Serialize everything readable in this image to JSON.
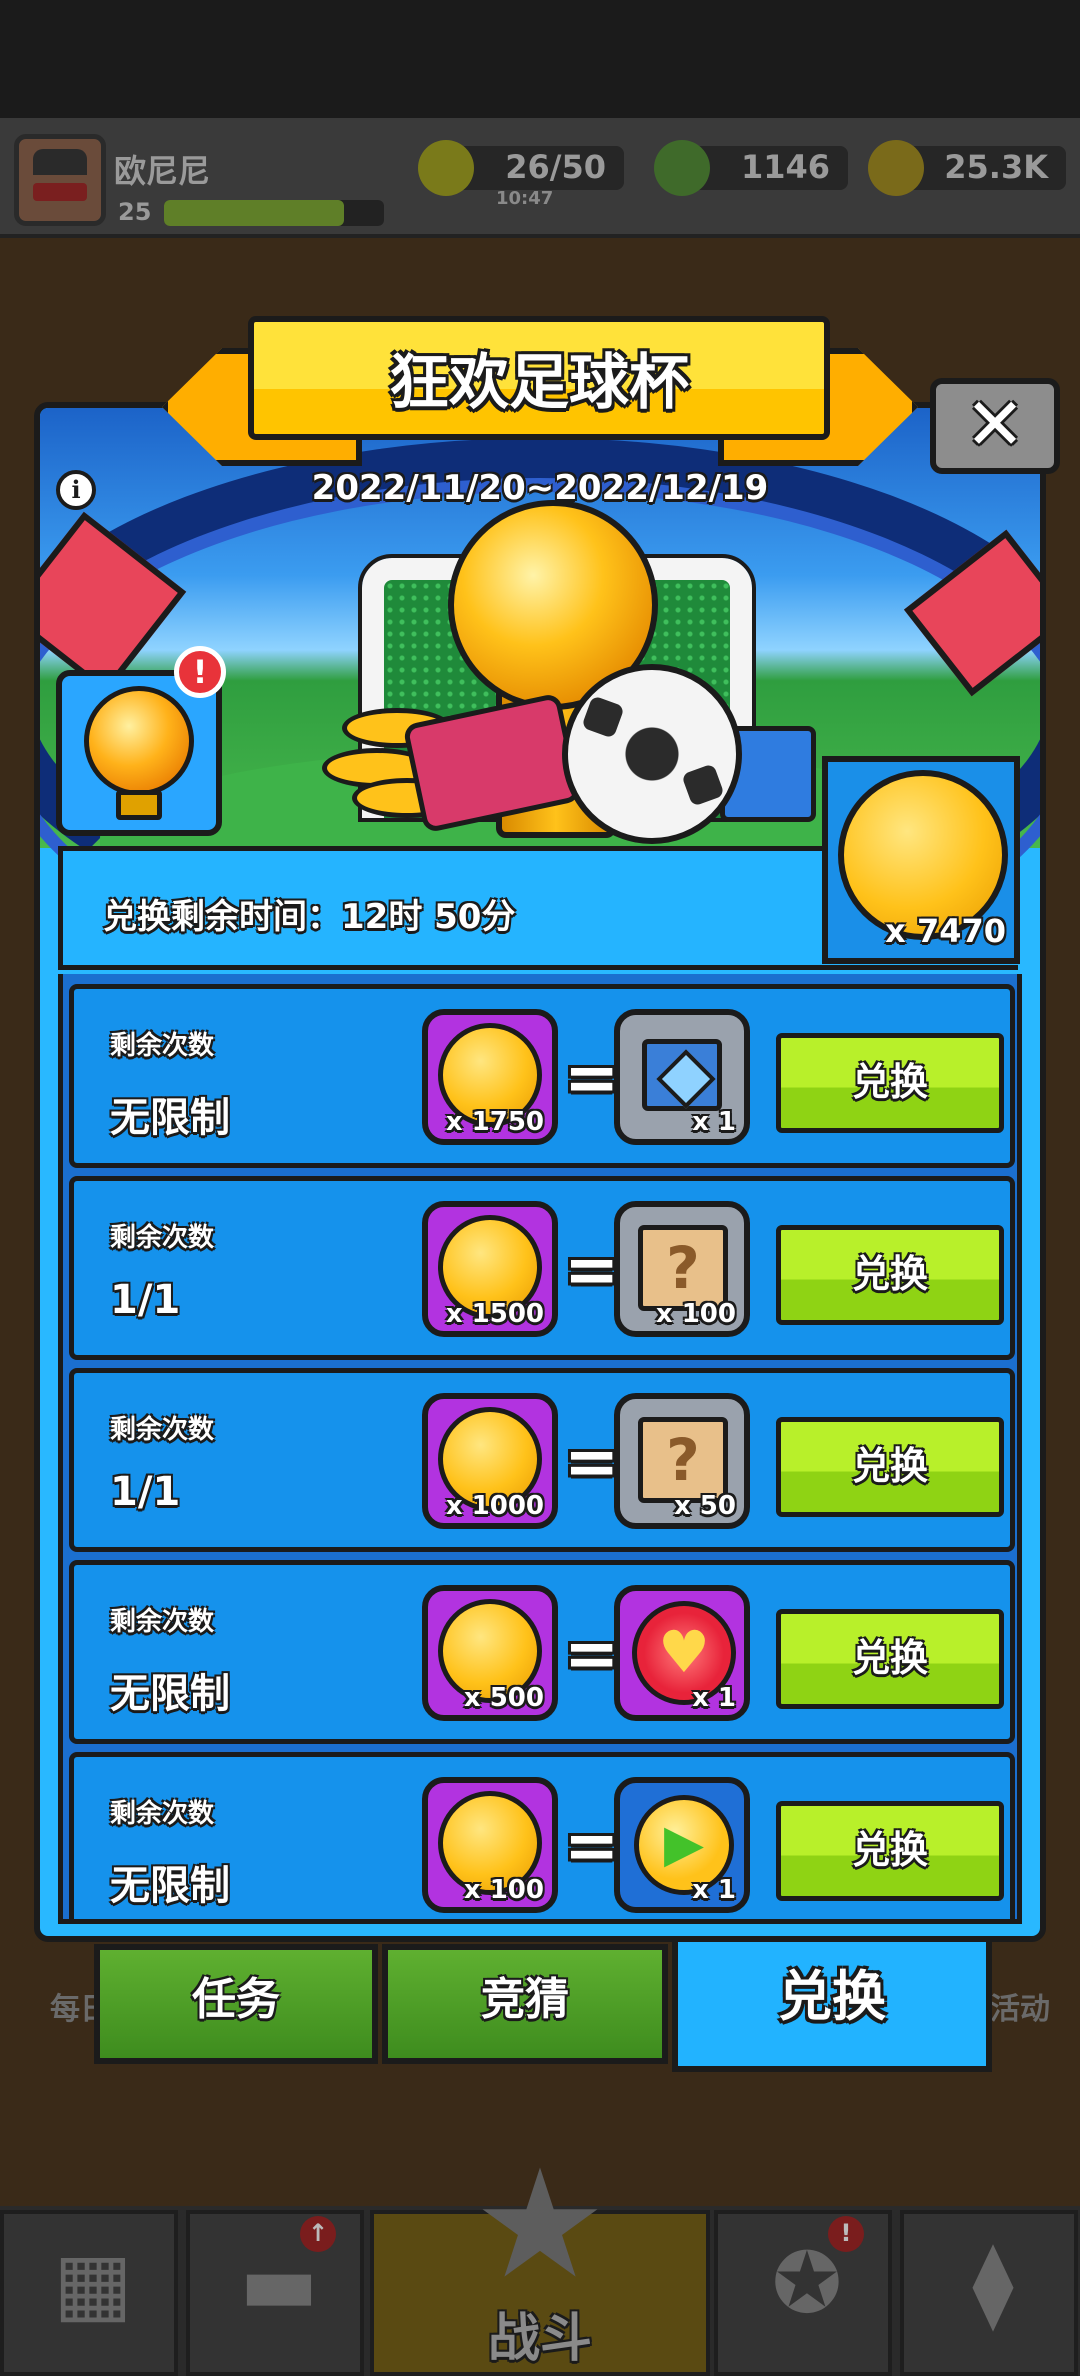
{
  "player": {
    "name": "欧尼尼",
    "level": "25",
    "xp_progress": 0.82
  },
  "resources": {
    "energy": {
      "value": "26/50",
      "timer": "10:47",
      "icon": "lightning-icon"
    },
    "gems": {
      "value": "1146",
      "icon": "gem-icon"
    },
    "coins": {
      "value": "25.3K",
      "icon": "coin-icon"
    }
  },
  "popup": {
    "title": "狂欢足球杯",
    "date_range": "2022/11/20~2022/12/19",
    "close_glyph": "✕",
    "info_glyph": "i",
    "alert_glyph": "!",
    "trophy_currency": "x 7470",
    "remaining_time": "兑换剩余时间：12时 50分"
  },
  "exchange": {
    "items": [
      {
        "label": "剩余次数",
        "limit": "无限制",
        "cost": "x 1750",
        "reward_icon": "chest-icon",
        "reward_qty": "x 1",
        "button": "兑换"
      },
      {
        "label": "剩余次数",
        "limit": "1/1",
        "cost": "x 1500",
        "reward_icon": "scroll-icon",
        "reward_qty": "x 100",
        "button": "兑换"
      },
      {
        "label": "剩余次数",
        "limit": "1/1",
        "cost": "x 1000",
        "reward_icon": "scroll-icon",
        "reward_qty": "x 50",
        "button": "兑换"
      },
      {
        "label": "剩余次数",
        "limit": "无限制",
        "cost": "x 500",
        "reward_icon": "heart-icon",
        "reward_qty": "x 1",
        "button": "兑换"
      },
      {
        "label": "剩余次数",
        "limit": "无限制",
        "cost": "x 100",
        "reward_icon": "refresh-coin-icon",
        "reward_qty": "x 1",
        "button": "兑换"
      }
    ],
    "equals": "="
  },
  "tabs": [
    {
      "label": "任务",
      "active": false
    },
    {
      "label": "竞猜",
      "active": false
    },
    {
      "label": "兑换",
      "active": true
    }
  ],
  "side_labels": {
    "left": "每日",
    "right": "活动"
  },
  "bottom_nav": {
    "battle_label": "战斗"
  },
  "colors": {
    "panel": "#29b8ff",
    "exchange_button": "#a6e21a",
    "active_tab": "#22b3ff",
    "tile_purple": "#b233e0"
  }
}
